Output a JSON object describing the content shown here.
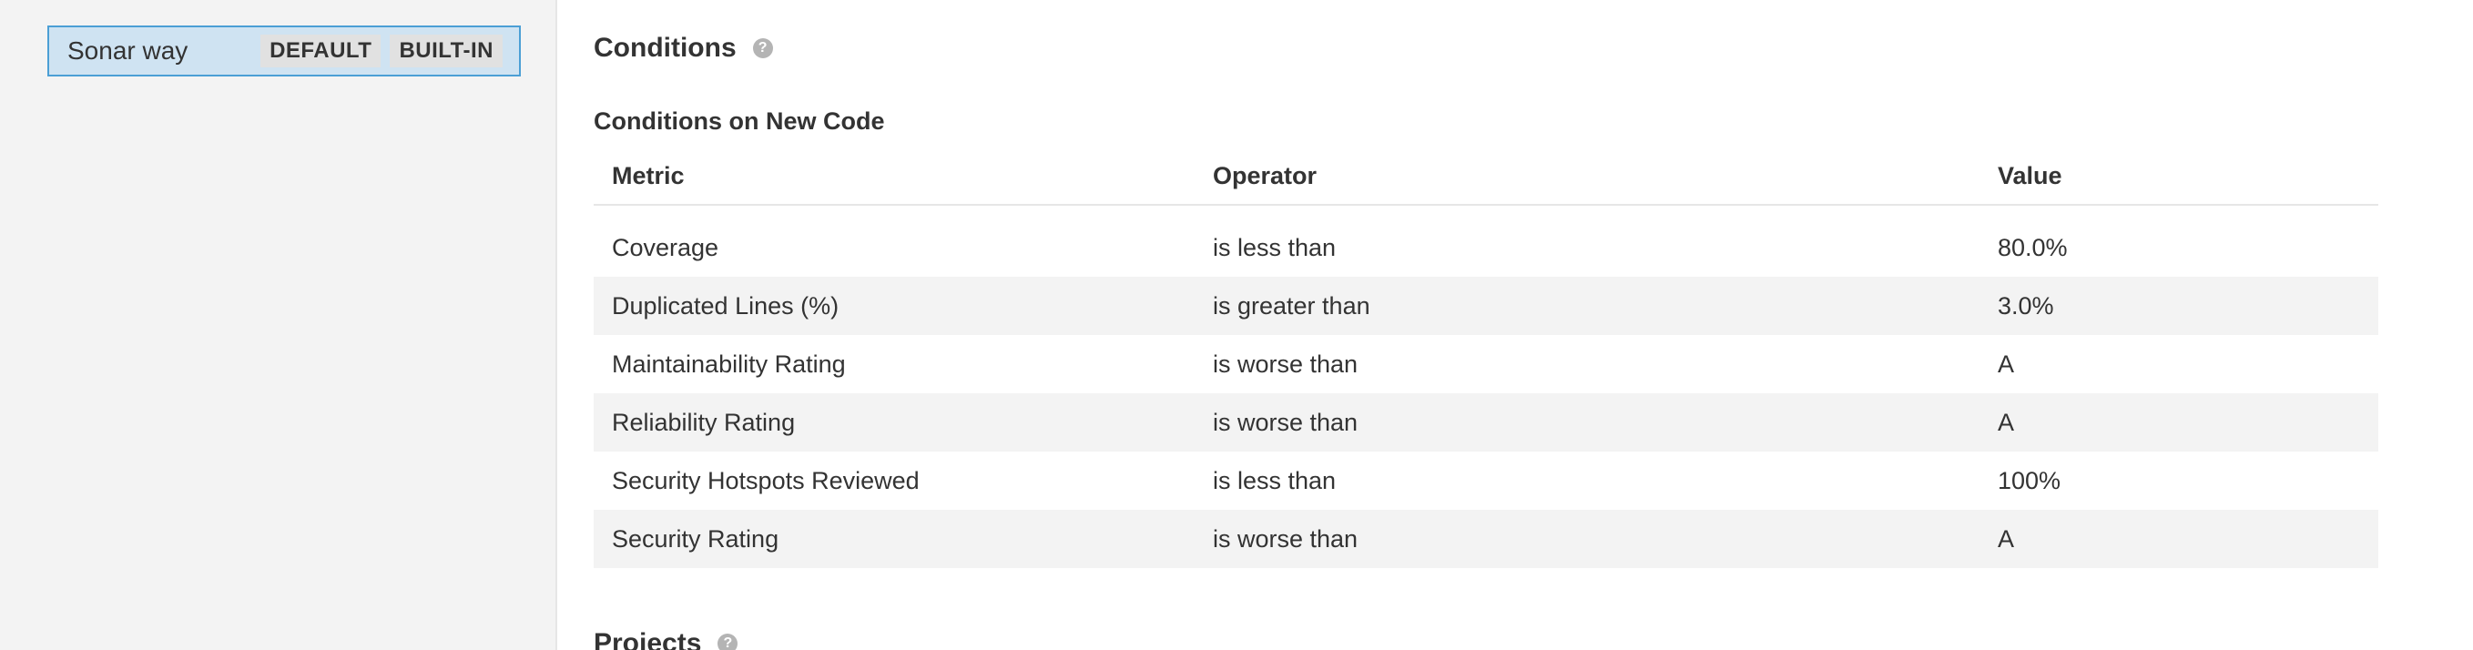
{
  "sidebar": {
    "profile": {
      "name": "Sonar way",
      "badges": [
        "DEFAULT",
        "BUILT-IN"
      ]
    }
  },
  "main": {
    "conditions_title": "Conditions",
    "help_icon": "question-circle-icon",
    "new_code_title": "Conditions on New Code",
    "table": {
      "headers": [
        "Metric",
        "Operator",
        "Value"
      ],
      "rows": [
        {
          "metric": "Coverage",
          "operator": "is less than",
          "value": "80.0%"
        },
        {
          "metric": "Duplicated Lines (%)",
          "operator": "is greater than",
          "value": "3.0%"
        },
        {
          "metric": "Maintainability Rating",
          "operator": "is worse than",
          "value": "A"
        },
        {
          "metric": "Reliability Rating",
          "operator": "is worse than",
          "value": "A"
        },
        {
          "metric": "Security Hotspots Reviewed",
          "operator": "is less than",
          "value": "100%"
        },
        {
          "metric": "Security Rating",
          "operator": "is worse than",
          "value": "A"
        }
      ]
    },
    "projects_title": "Projects"
  },
  "colors": {
    "selected_bg": "#cfe3f2",
    "selected_border": "#4b9fd5",
    "sidebar_bg": "#f3f3f3",
    "stripe_bg": "#f3f3f3"
  }
}
